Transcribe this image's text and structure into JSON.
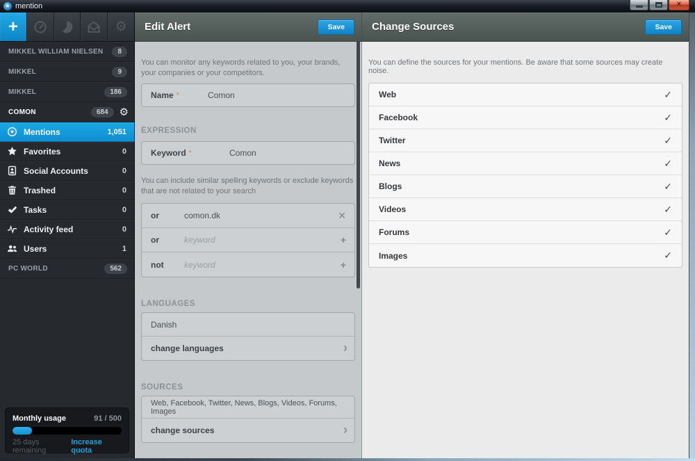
{
  "titlebar": {
    "app_title": "mention",
    "window_controls": [
      "minimize-icon",
      "maximize-icon",
      "close-icon"
    ]
  },
  "toolbar": {
    "buttons": [
      {
        "name": "new-alert",
        "icon": "plus-icon",
        "active": true
      },
      {
        "name": "dashboard",
        "icon": "gauge-icon",
        "active": false
      },
      {
        "name": "statistics",
        "icon": "pie-chart-icon",
        "active": false
      },
      {
        "name": "messages",
        "icon": "envelope-icon",
        "active": false
      },
      {
        "name": "settings",
        "icon": "gear-icon",
        "active": false
      }
    ]
  },
  "sidebar": {
    "alerts": [
      {
        "name": "MIKKEL WILLIAM NIELSEN",
        "count": "8",
        "has_gear": false,
        "active": false
      },
      {
        "name": "MIKKEL",
        "count": "9",
        "has_gear": false,
        "active": false
      },
      {
        "name": "MIKKEL",
        "count": "186",
        "has_gear": false,
        "active": false
      },
      {
        "name": "COMON",
        "count": "684",
        "has_gear": true,
        "active": true
      }
    ],
    "nav": [
      {
        "label": "Mentions",
        "count": "1,051",
        "icon": "mention-icon",
        "active": true
      },
      {
        "label": "Favorites",
        "count": "0",
        "icon": "star-icon",
        "active": false
      },
      {
        "label": "Social Accounts",
        "count": "0",
        "icon": "contact-card-icon",
        "active": false
      },
      {
        "label": "Trashed",
        "count": "0",
        "icon": "trash-icon",
        "active": false
      },
      {
        "label": "Tasks",
        "count": "0",
        "icon": "check-icon",
        "active": false
      },
      {
        "label": "Activity feed",
        "count": "0",
        "icon": "activity-icon",
        "active": false
      },
      {
        "label": "Users",
        "count": "1",
        "icon": "users-icon",
        "active": false
      }
    ],
    "footer_alert": {
      "name": "PC WORLD",
      "count": "562"
    },
    "usage": {
      "title": "Monthly usage",
      "quota": "91 / 500",
      "percent": 18,
      "remaining": "25 days remaining",
      "increase_link": "Increase quota"
    }
  },
  "edit_alert": {
    "title": "Edit Alert",
    "save_label": "Save",
    "intro": "You can monitor any keywords related to you, your brands, your companies or your competitors.",
    "name_field": {
      "label": "Name",
      "required_mark": "*",
      "value": "Comon"
    },
    "expression": {
      "section_label": "EXPRESSION",
      "keyword_field": {
        "label": "Keyword",
        "required_mark": "*",
        "value": "Comon"
      },
      "hint": "You can include similar spelling keywords or exclude keywords that are not related to your search",
      "rows": [
        {
          "operator": "or",
          "value": "comon.dk",
          "placeholder": "",
          "action": "remove"
        },
        {
          "operator": "or",
          "value": "",
          "placeholder": "keyword",
          "action": "add"
        },
        {
          "operator": "not",
          "value": "",
          "placeholder": "keyword",
          "action": "add"
        }
      ]
    },
    "languages": {
      "section_label": "LANGUAGES",
      "current": "Danish",
      "change_label": "change languages"
    },
    "sources": {
      "section_label": "SOURCES",
      "current": "Web, Facebook, Twitter, News, Blogs, Videos, Forums, Images",
      "change_label": "change sources"
    }
  },
  "change_sources": {
    "title": "Change Sources",
    "save_label": "Save",
    "intro": "You can define the sources for your mentions. Be aware that some sources may create noise.",
    "sources": [
      {
        "name": "Web",
        "checked": true
      },
      {
        "name": "Facebook",
        "checked": true
      },
      {
        "name": "Twitter",
        "checked": true
      },
      {
        "name": "News",
        "checked": true
      },
      {
        "name": "Blogs",
        "checked": true
      },
      {
        "name": "Videos",
        "checked": true
      },
      {
        "name": "Forums",
        "checked": true
      },
      {
        "name": "Images",
        "checked": true
      }
    ]
  },
  "colors": {
    "accent_blue": "#18a0de",
    "sidebar_bg": "#26292e",
    "panel_gray": "#c6c9cb",
    "panel_light": "#ebebec",
    "header_green_gray": "#55605d"
  }
}
